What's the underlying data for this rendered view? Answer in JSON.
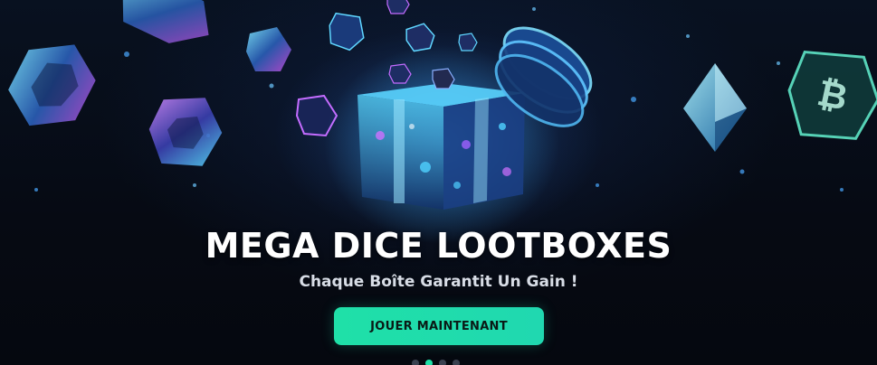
{
  "banner": {
    "title": "MEGA DICE LOOTBOXES",
    "subtitle": "Chaque Boîte Garantit Un Gain !",
    "cta_label": "JOUER MAINTENANT",
    "slides": {
      "count": 4,
      "active_index": 1
    }
  },
  "colors": {
    "accent": "#1fe0a8",
    "background": "#070b14",
    "title": "#ffffff"
  },
  "icons": [
    "gift-box-icon",
    "gem-icon",
    "ethereum-icon",
    "bitcoin-icon",
    "coin-stack-icon"
  ]
}
